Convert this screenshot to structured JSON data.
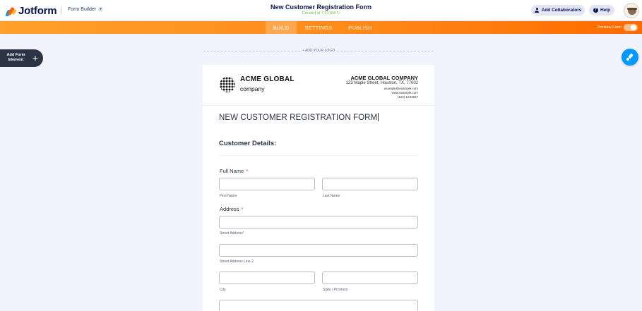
{
  "app": {
    "brand": "Jotform",
    "builder_label": "Form Builder",
    "form_title": "New Customer Registration Form",
    "form_subtitle": "Created at 7:01 AM"
  },
  "header_buttons": {
    "collaborators": "Add Collaborators",
    "help": "Help"
  },
  "nav": {
    "tabs": [
      "BUILD",
      "SETTINGS",
      "PUBLISH"
    ],
    "active_tab": "BUILD",
    "preview_label": "Preview Form"
  },
  "sidebar": {
    "add_element_label": "Add Form Element",
    "add_element_icon": "+"
  },
  "canvas": {
    "add_logo_label": "+ ADD YOUR LOGO"
  },
  "form_header": {
    "logo_name": "ACME GLOBAL",
    "logo_sub": "company",
    "company_name": "ACME GLOBAL COMPANY",
    "address": "123 Maple Street, Houston, TX, 77002",
    "email": "example@example.com",
    "website": "www.example.com",
    "phone": "(123) 1234567"
  },
  "form": {
    "heading": "NEW CUSTOMER REGISTRATION FORM",
    "section_title": "Customer Details:",
    "full_name": {
      "label": "Full Name",
      "required_mark": "*",
      "first_label": "First Name",
      "last_label": "Last Name"
    },
    "address": {
      "label": "Address",
      "required_mark": "*",
      "street_label": "Street Address",
      "street_required_mark": "*",
      "street2_label": "Street Address Line 2",
      "city_label": "City",
      "state_label": "State / Province"
    }
  },
  "colors": {
    "nav_orange": "#ff8a18",
    "accent_blue": "#0099ff",
    "required_red": "#f23a3c",
    "dark_navy": "#0a1551"
  }
}
